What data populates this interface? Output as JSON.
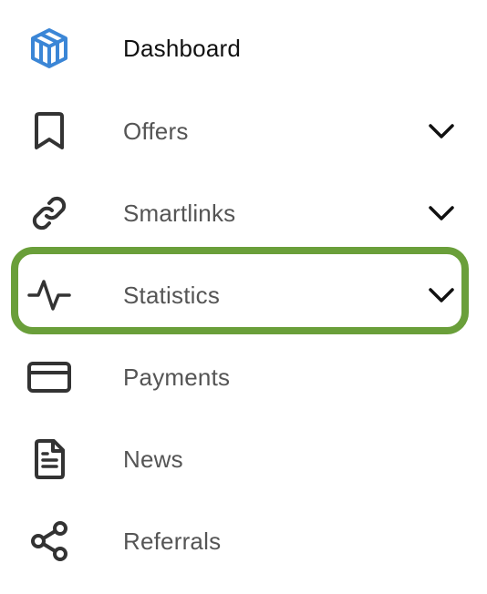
{
  "accent_color": "#6a9f3a",
  "brand_icon_color": "#3b86d6",
  "menu": {
    "items": [
      {
        "label": "Dashboard",
        "icon": "cube-logo-icon",
        "has_dropdown": false,
        "emphasis": "primary"
      },
      {
        "label": "Offers",
        "icon": "bookmark-icon",
        "has_dropdown": true
      },
      {
        "label": "Smartlinks",
        "icon": "link-icon",
        "has_dropdown": true
      },
      {
        "label": "Statistics",
        "icon": "activity-icon",
        "has_dropdown": true,
        "highlighted": true
      },
      {
        "label": "Payments",
        "icon": "credit-card-icon",
        "has_dropdown": false
      },
      {
        "label": "News",
        "icon": "document-icon",
        "has_dropdown": false
      },
      {
        "label": "Referrals",
        "icon": "share-icon",
        "has_dropdown": false
      }
    ]
  }
}
